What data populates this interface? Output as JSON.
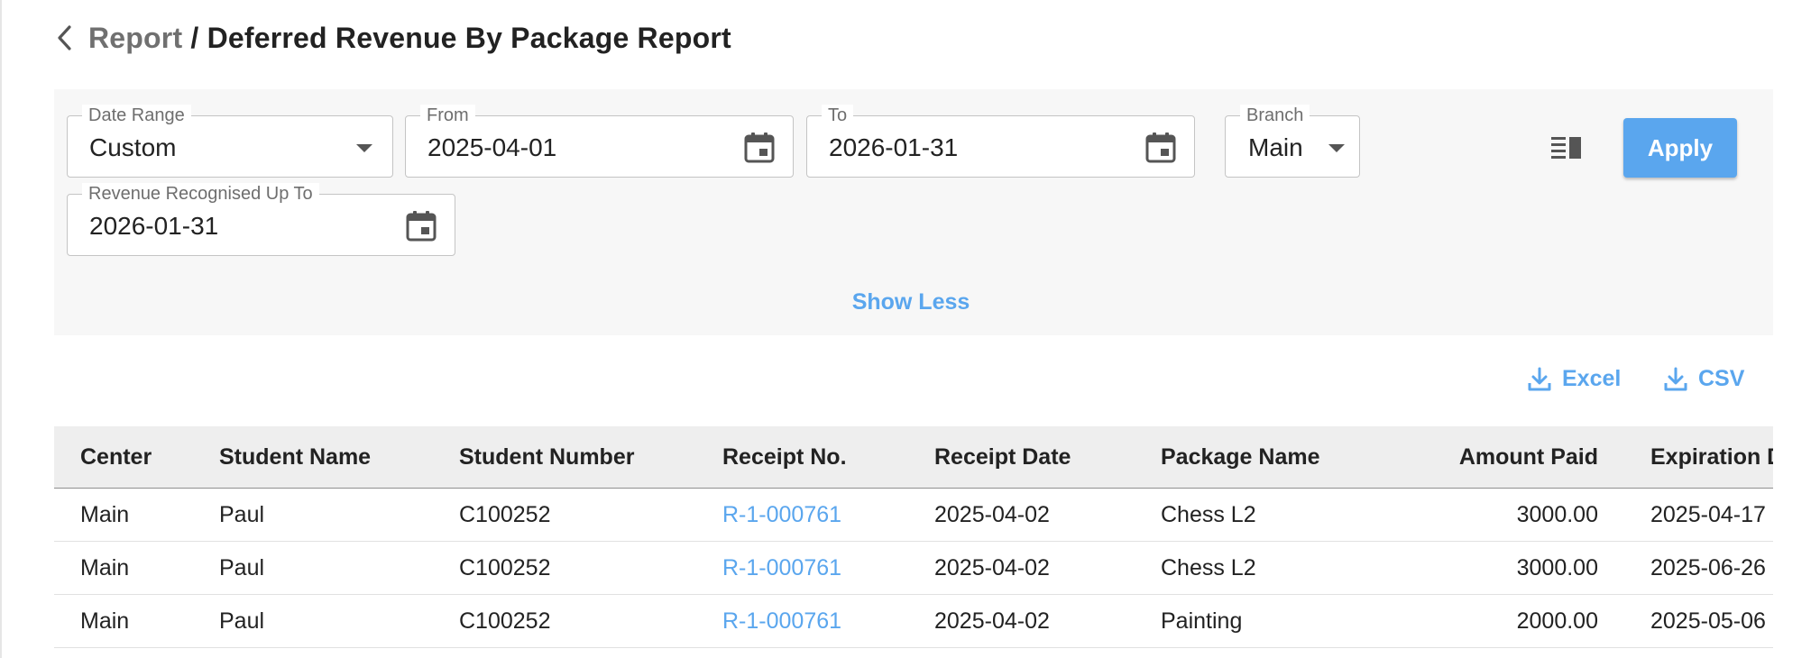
{
  "header": {
    "breadcrumb": "Report",
    "separator": " / ",
    "title": "Deferred Revenue By Package Report"
  },
  "filters": {
    "date_range": {
      "label": "Date Range",
      "value": "Custom"
    },
    "from": {
      "label": "From",
      "value": "2025-04-01"
    },
    "to": {
      "label": "To",
      "value": "2026-01-31"
    },
    "branch": {
      "label": "Branch",
      "value": "Main"
    },
    "recognised_up_to": {
      "label": "Revenue Recognised Up To",
      "value": "2026-01-31"
    },
    "apply_label": "Apply",
    "show_less_label": "Show Less"
  },
  "exports": {
    "excel_label": "Excel",
    "csv_label": "CSV"
  },
  "table": {
    "columns": [
      "Center",
      "Student Name",
      "Student Number",
      "Receipt No.",
      "Receipt Date",
      "Package Name",
      "Amount Paid",
      "Expiration D"
    ],
    "rows": [
      [
        "Main",
        "Paul",
        "C100252",
        "R-1-000761",
        "2025-04-02",
        "Chess L2",
        "3000.00",
        "2025-04-17"
      ],
      [
        "Main",
        "Paul",
        "C100252",
        "R-1-000761",
        "2025-04-02",
        "Chess L2",
        "3000.00",
        "2025-06-26"
      ],
      [
        "Main",
        "Paul",
        "C100252",
        "R-1-000761",
        "2025-04-02",
        "Painting",
        "2000.00",
        "2025-05-06"
      ]
    ]
  },
  "colors": {
    "accent": "#5aa6ee",
    "panel": "#f7f7f7",
    "header_row": "#eeeeee"
  },
  "icons": {
    "back": "chevron-left-icon",
    "calendar": "calendar-icon",
    "dropdown": "caret-down-icon",
    "columns": "view-columns-icon",
    "download": "download-icon"
  }
}
